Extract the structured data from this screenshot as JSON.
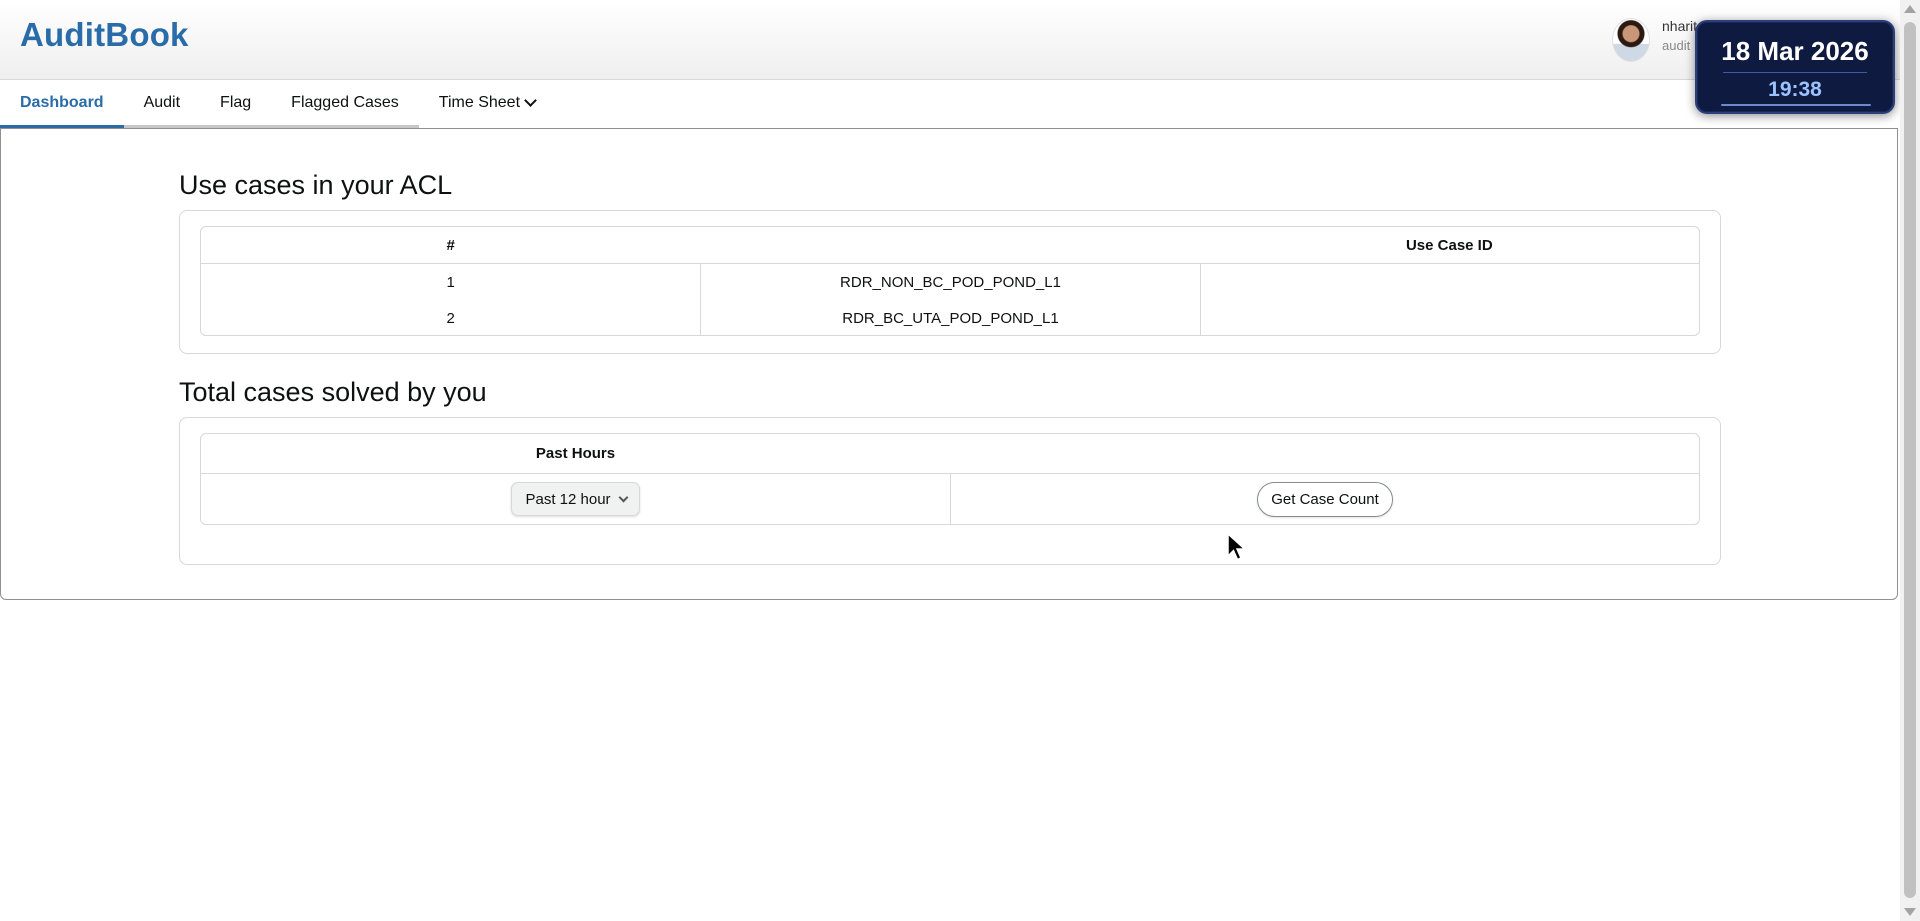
{
  "app": {
    "title": "AuditBook",
    "user_name": "nharit",
    "user_role": "audit"
  },
  "clock": {
    "date": "18 Mar 2026",
    "time": "19:38"
  },
  "tabs": [
    {
      "label": "Dashboard",
      "active": true
    },
    {
      "label": "Audit",
      "active": false
    },
    {
      "label": "Flag",
      "active": false
    },
    {
      "label": "Flagged Cases",
      "active": false
    },
    {
      "label": "Time Sheet",
      "active": false
    }
  ],
  "acl": {
    "title": "Use cases in your ACL",
    "headers": [
      "#",
      "Use Case ID"
    ],
    "rows": [
      {
        "index": "1",
        "use_case_id": "RDR_NON_BC_POD_POND_L1"
      },
      {
        "index": "2",
        "use_case_id": "RDR_BC_UTA_POD_POND_L1"
      }
    ]
  },
  "solved": {
    "title": "Total cases solved by you",
    "header": "Past Hours",
    "select_value": "Past 12 hour",
    "button_label": "Get Case Count"
  },
  "colors": {
    "brand": "#2a6ca8",
    "clock_bg": "#0e1a3f",
    "clock_time": "#9cc3ff"
  }
}
